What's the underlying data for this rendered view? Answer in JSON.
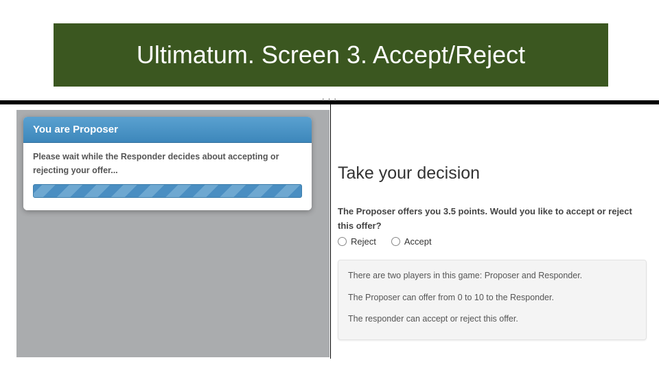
{
  "header": {
    "title": "Ultimatum. Screen 3. Accept/Reject"
  },
  "dots": ". . .",
  "proposer": {
    "role_label": "You are Proposer",
    "wait_text": "Please wait while the Responder decides about accepting or rejecting your offer..."
  },
  "responder": {
    "heading": "Take your decision",
    "question": "The Proposer offers you 3.5 points. Would you like to accept or reject this offer?",
    "options": {
      "reject": "Reject",
      "accept": "Accept"
    },
    "info": {
      "line1": "There are two players in this game: Proposer and Responder.",
      "line2": "The Proposer can offer from 0 to 10 to the Responder.",
      "line3": "The responder can accept or reject this offer."
    }
  },
  "colors": {
    "header_bg": "#3b5720",
    "card_header_bg": "#3d87bb",
    "progress_stripe_a": "#4a8ec2",
    "progress_stripe_b": "#6ea8d1",
    "left_bg": "#aaacae"
  }
}
